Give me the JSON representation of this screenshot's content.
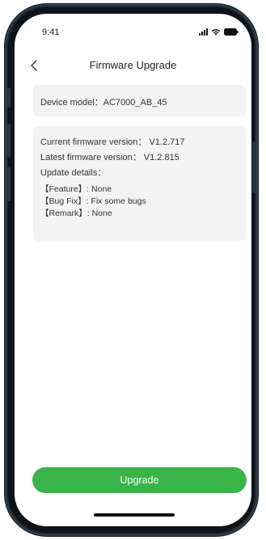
{
  "status_bar": {
    "time": "9:41",
    "icons": [
      "signal-icon",
      "wifi-icon",
      "battery-icon"
    ]
  },
  "nav": {
    "back_icon": "chevron-left-icon",
    "title": "Firmware Upgrade"
  },
  "device": {
    "model_line": "Device model：AC7000_AB_45"
  },
  "firmware": {
    "current_line": "Current firmware version： V1.2.717",
    "latest_line": "Latest firmware version： V1.2.815",
    "update_details_label": "Update details：",
    "details": [
      "【Feature】: None",
      "【Bug Fix】: Fix some bugs",
      "【Remark】: None"
    ]
  },
  "actions": {
    "upgrade_label": "Upgrade"
  },
  "colors": {
    "accent": "#38b449",
    "card_background": "#f3f3f3",
    "frame": "#1d2a33"
  }
}
